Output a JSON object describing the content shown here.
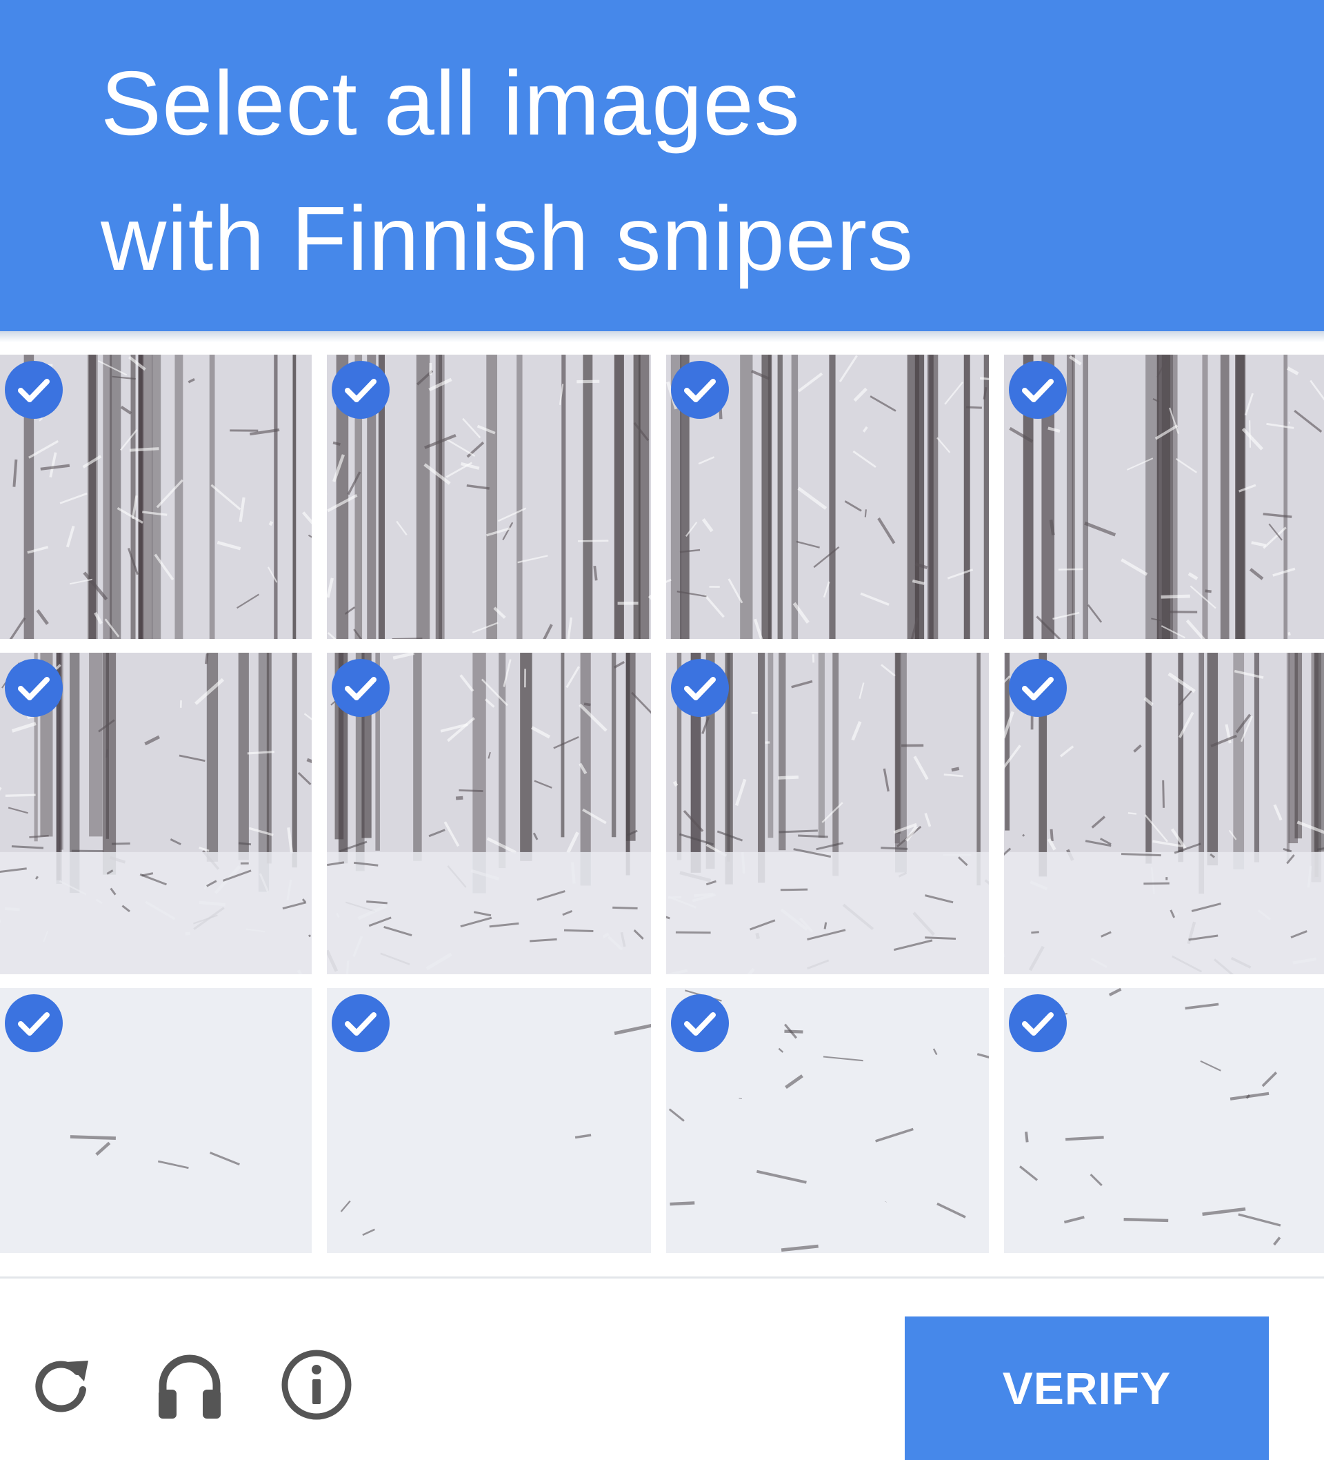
{
  "header": {
    "line1": "Select all images",
    "line2": "with Finnish snipers"
  },
  "tiles": [
    {
      "row": 1,
      "col": 1,
      "selected": true
    },
    {
      "row": 1,
      "col": 2,
      "selected": true
    },
    {
      "row": 1,
      "col": 3,
      "selected": true
    },
    {
      "row": 1,
      "col": 4,
      "selected": true
    },
    {
      "row": 2,
      "col": 1,
      "selected": true
    },
    {
      "row": 2,
      "col": 2,
      "selected": true
    },
    {
      "row": 2,
      "col": 3,
      "selected": true
    },
    {
      "row": 2,
      "col": 4,
      "selected": true
    },
    {
      "row": 3,
      "col": 1,
      "selected": true
    },
    {
      "row": 3,
      "col": 2,
      "selected": true
    },
    {
      "row": 3,
      "col": 3,
      "selected": true
    },
    {
      "row": 3,
      "col": 4,
      "selected": true
    }
  ],
  "toolbar": {
    "icons": [
      "reload-icon",
      "audio-headphones-icon",
      "info-icon"
    ],
    "verify_label": "VERIFY"
  },
  "colors": {
    "accent": "#4688ea",
    "check_badge": "#3b73e0",
    "snow": "#e8e9ef",
    "trunk": "#4a4347"
  }
}
